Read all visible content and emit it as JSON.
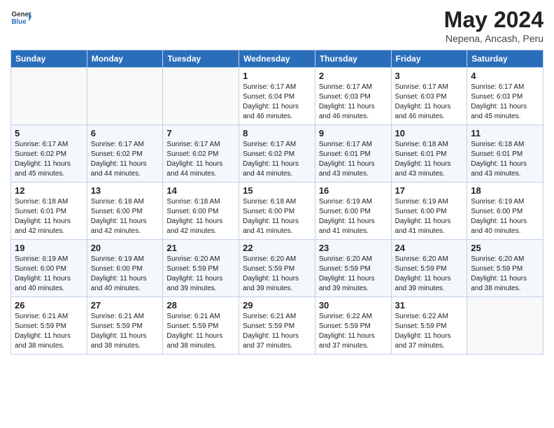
{
  "header": {
    "logo_line1": "General",
    "logo_line2": "Blue",
    "month_year": "May 2024",
    "location": "Nepena, Ancash, Peru"
  },
  "weekdays": [
    "Sunday",
    "Monday",
    "Tuesday",
    "Wednesday",
    "Thursday",
    "Friday",
    "Saturday"
  ],
  "weeks": [
    [
      {
        "day": "",
        "info": ""
      },
      {
        "day": "",
        "info": ""
      },
      {
        "day": "",
        "info": ""
      },
      {
        "day": "1",
        "info": "Sunrise: 6:17 AM\nSunset: 6:04 PM\nDaylight: 11 hours\nand 46 minutes."
      },
      {
        "day": "2",
        "info": "Sunrise: 6:17 AM\nSunset: 6:03 PM\nDaylight: 11 hours\nand 46 minutes."
      },
      {
        "day": "3",
        "info": "Sunrise: 6:17 AM\nSunset: 6:03 PM\nDaylight: 11 hours\nand 46 minutes."
      },
      {
        "day": "4",
        "info": "Sunrise: 6:17 AM\nSunset: 6:03 PM\nDaylight: 11 hours\nand 45 minutes."
      }
    ],
    [
      {
        "day": "5",
        "info": "Sunrise: 6:17 AM\nSunset: 6:02 PM\nDaylight: 11 hours\nand 45 minutes."
      },
      {
        "day": "6",
        "info": "Sunrise: 6:17 AM\nSunset: 6:02 PM\nDaylight: 11 hours\nand 44 minutes."
      },
      {
        "day": "7",
        "info": "Sunrise: 6:17 AM\nSunset: 6:02 PM\nDaylight: 11 hours\nand 44 minutes."
      },
      {
        "day": "8",
        "info": "Sunrise: 6:17 AM\nSunset: 6:02 PM\nDaylight: 11 hours\nand 44 minutes."
      },
      {
        "day": "9",
        "info": "Sunrise: 6:17 AM\nSunset: 6:01 PM\nDaylight: 11 hours\nand 43 minutes."
      },
      {
        "day": "10",
        "info": "Sunrise: 6:18 AM\nSunset: 6:01 PM\nDaylight: 11 hours\nand 43 minutes."
      },
      {
        "day": "11",
        "info": "Sunrise: 6:18 AM\nSunset: 6:01 PM\nDaylight: 11 hours\nand 43 minutes."
      }
    ],
    [
      {
        "day": "12",
        "info": "Sunrise: 6:18 AM\nSunset: 6:01 PM\nDaylight: 11 hours\nand 42 minutes."
      },
      {
        "day": "13",
        "info": "Sunrise: 6:18 AM\nSunset: 6:00 PM\nDaylight: 11 hours\nand 42 minutes."
      },
      {
        "day": "14",
        "info": "Sunrise: 6:18 AM\nSunset: 6:00 PM\nDaylight: 11 hours\nand 42 minutes."
      },
      {
        "day": "15",
        "info": "Sunrise: 6:18 AM\nSunset: 6:00 PM\nDaylight: 11 hours\nand 41 minutes."
      },
      {
        "day": "16",
        "info": "Sunrise: 6:19 AM\nSunset: 6:00 PM\nDaylight: 11 hours\nand 41 minutes."
      },
      {
        "day": "17",
        "info": "Sunrise: 6:19 AM\nSunset: 6:00 PM\nDaylight: 11 hours\nand 41 minutes."
      },
      {
        "day": "18",
        "info": "Sunrise: 6:19 AM\nSunset: 6:00 PM\nDaylight: 11 hours\nand 40 minutes."
      }
    ],
    [
      {
        "day": "19",
        "info": "Sunrise: 6:19 AM\nSunset: 6:00 PM\nDaylight: 11 hours\nand 40 minutes."
      },
      {
        "day": "20",
        "info": "Sunrise: 6:19 AM\nSunset: 6:00 PM\nDaylight: 11 hours\nand 40 minutes."
      },
      {
        "day": "21",
        "info": "Sunrise: 6:20 AM\nSunset: 5:59 PM\nDaylight: 11 hours\nand 39 minutes."
      },
      {
        "day": "22",
        "info": "Sunrise: 6:20 AM\nSunset: 5:59 PM\nDaylight: 11 hours\nand 39 minutes."
      },
      {
        "day": "23",
        "info": "Sunrise: 6:20 AM\nSunset: 5:59 PM\nDaylight: 11 hours\nand 39 minutes."
      },
      {
        "day": "24",
        "info": "Sunrise: 6:20 AM\nSunset: 5:59 PM\nDaylight: 11 hours\nand 39 minutes."
      },
      {
        "day": "25",
        "info": "Sunrise: 6:20 AM\nSunset: 5:59 PM\nDaylight: 11 hours\nand 38 minutes."
      }
    ],
    [
      {
        "day": "26",
        "info": "Sunrise: 6:21 AM\nSunset: 5:59 PM\nDaylight: 11 hours\nand 38 minutes."
      },
      {
        "day": "27",
        "info": "Sunrise: 6:21 AM\nSunset: 5:59 PM\nDaylight: 11 hours\nand 38 minutes."
      },
      {
        "day": "28",
        "info": "Sunrise: 6:21 AM\nSunset: 5:59 PM\nDaylight: 11 hours\nand 38 minutes."
      },
      {
        "day": "29",
        "info": "Sunrise: 6:21 AM\nSunset: 5:59 PM\nDaylight: 11 hours\nand 37 minutes."
      },
      {
        "day": "30",
        "info": "Sunrise: 6:22 AM\nSunset: 5:59 PM\nDaylight: 11 hours\nand 37 minutes."
      },
      {
        "day": "31",
        "info": "Sunrise: 6:22 AM\nSunset: 5:59 PM\nDaylight: 11 hours\nand 37 minutes."
      },
      {
        "day": "",
        "info": ""
      }
    ]
  ]
}
